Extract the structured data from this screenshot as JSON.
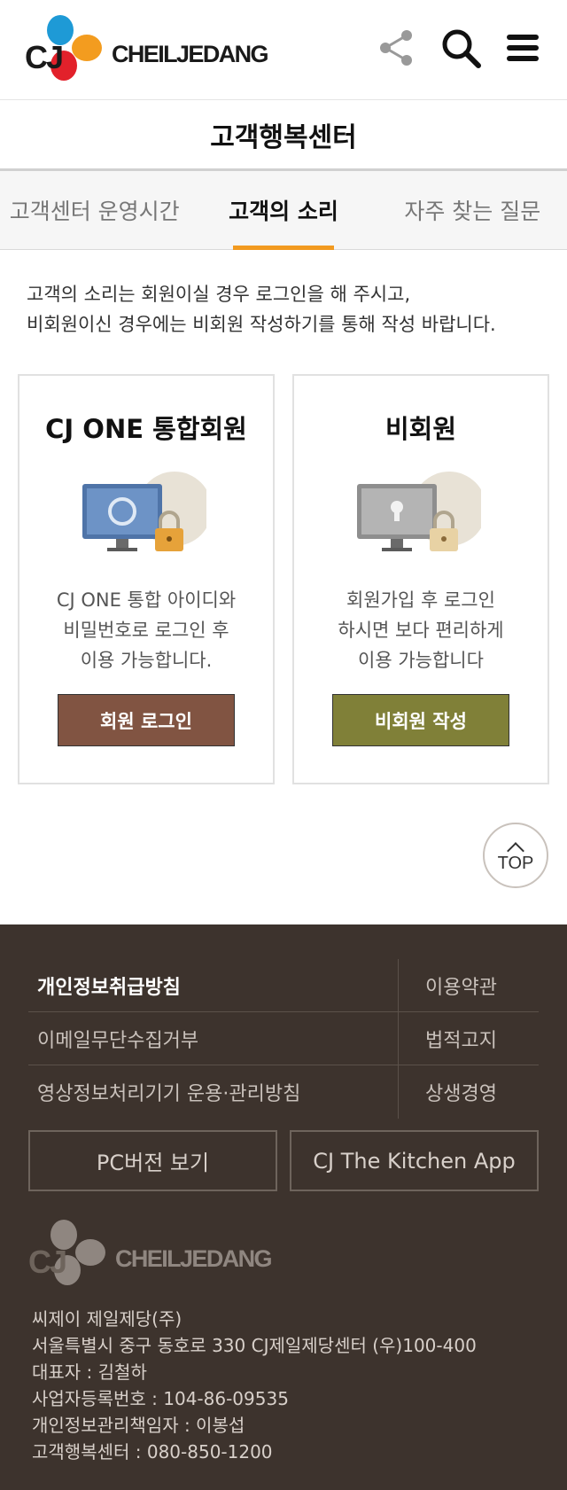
{
  "header": {
    "logo_cj": "CJ",
    "logo_name": "CHEILJEDANG",
    "icons": [
      "share-icon",
      "search-icon",
      "menu-icon"
    ]
  },
  "page_title": "고객행복센터",
  "tabs": [
    {
      "label": "고객센터 운영시간",
      "active": false
    },
    {
      "label": "고객의 소리",
      "active": true
    },
    {
      "label": "자주 찾는 질문",
      "active": false
    }
  ],
  "intro": {
    "line1": "고객의 소리는 회원이실 경우 로그인을 해 주시고,",
    "line2": "비회원이신 경우에는 비회원 작성하기를 통해 작성 바랍니다."
  },
  "cards": {
    "member": {
      "title": "CJ ONE 통합회원",
      "desc": "CJ ONE 통합 아이디와\n비밀번호로 로그인 후\n이용 가능합니다.",
      "button": "회원 로그인"
    },
    "guest": {
      "title": "비회원",
      "desc": "회원가입 후 로그인\n하시면 보다 편리하게\n이용 가능합니다",
      "button": "비회원 작성"
    }
  },
  "top_button": "TOP",
  "footer": {
    "links": [
      {
        "left": "개인정보취급방침",
        "right": "이용약관"
      },
      {
        "left": "이메일무단수집거부",
        "right": "법적고지"
      },
      {
        "left": "영상정보처리기기 운용·관리방침",
        "right": "상생경영"
      }
    ],
    "buttons": [
      "PC버전 보기",
      "CJ The Kitchen App"
    ],
    "logo_cj": "CJ",
    "logo_name": "CHEILJEDANG",
    "info": [
      "씨제이 제일제당(주)",
      "서울특별시 중구 동호로 330 CJ제일제당센터 (우)100-400",
      "대표자 : 김철하",
      "사업자등록번호 : 104-86-09535",
      "개인정보관리책임자 : 이봉섭",
      "고객행복센터 : 080-850-1200"
    ]
  },
  "colors": {
    "accent": "#f29a1f",
    "member_button": "#815442",
    "guest_button": "#808038",
    "footer_bg": "#3d332d"
  }
}
